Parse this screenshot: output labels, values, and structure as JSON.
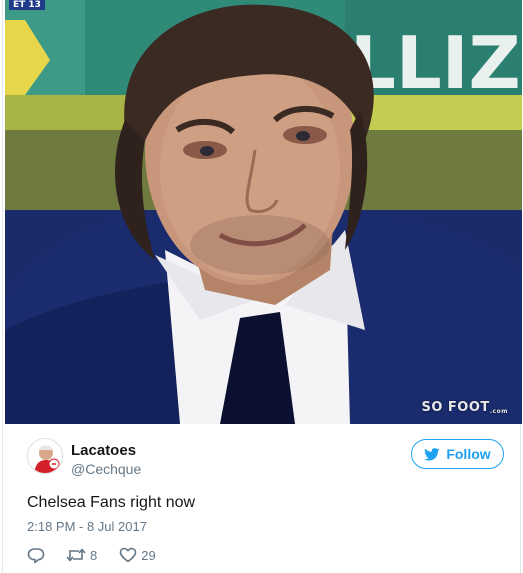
{
  "media": {
    "score_tag": "ET 13",
    "banner_text": "LLI Z",
    "watermark": "SO FOOT",
    "watermark_suffix": ".com"
  },
  "author": {
    "name": "Lacatoes",
    "handle": "@Cechque"
  },
  "follow": {
    "label": "Follow"
  },
  "tweet": {
    "text": "Chelsea Fans right now",
    "timestamp": "2:18 PM - 8 Jul 2017"
  },
  "actions": {
    "retweet_count": "8",
    "like_count": "29"
  },
  "colors": {
    "accent": "#1da1f2",
    "text": "#14171a",
    "muted": "#657786"
  }
}
